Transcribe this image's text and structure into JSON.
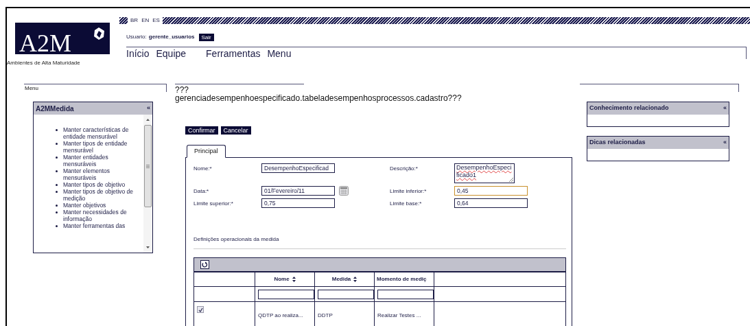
{
  "languages": [
    "BR",
    "EN",
    "ES"
  ],
  "logo": {
    "text": "A2M",
    "subtitle": "Ambientes de Alta Maturidade"
  },
  "user": {
    "label": "Usuario:",
    "name": "gerente_usuarios",
    "logout": "Sair"
  },
  "nav": [
    "Início",
    "Equipe",
    "Ferramentas",
    "Menu"
  ],
  "left_header": "Menu",
  "menu_box": {
    "title": "A2MMedida",
    "collapse": "«",
    "items": [
      "Manter características de entidade mensurável",
      "Manter tipos de entidade mensurável",
      "Manter entidades mensuráveis",
      "Manter elementos mensuráveis",
      "Manter tipos de objetivo",
      "Manter tipos de objetivo de medição",
      "Manter objetivos",
      "Manter necessidades de informação",
      "Manter ferramentas das"
    ]
  },
  "page_title": "???\ngerenciadesempenhoespecificado.tabeladesempenhosprocessos.cadastro???",
  "buttons": [
    "Confirmar",
    "Cancelar"
  ],
  "tabs": [
    {
      "label": "Principal",
      "selected": true
    }
  ],
  "form": [
    {
      "label": "Nome:*",
      "value": "DesempenhoEspecificad",
      "kind": "text",
      "focused": false
    },
    {
      "label": "Descrição:*",
      "value": "DesempenhoEspecificado1",
      "kind": "textarea",
      "focused": false
    },
    {
      "label": "Data:*",
      "value": "01/Fevereiro/11",
      "kind": "date",
      "focused": false
    },
    {
      "label": "Limite inferior:*",
      "value": "0,45",
      "kind": "text",
      "focused": true
    },
    {
      "label": "Limite superior:*",
      "value": "0,75",
      "kind": "text",
      "focused": false
    },
    {
      "label": "Limite base:*",
      "value": "0,64",
      "kind": "text",
      "focused": false
    }
  ],
  "section_title": "Definições operacionais da medida",
  "table": {
    "columns": [
      {
        "label": "Nome",
        "sortable": true
      },
      {
        "label": "Medida",
        "sortable": true
      },
      {
        "label": "Momento de mediç",
        "sortable": false
      }
    ],
    "rows": [
      {
        "checked": true,
        "cells": [
          "QDTP ao realiza...",
          "DDTP",
          "Realizar Testes ..."
        ]
      }
    ]
  },
  "right_panels": [
    {
      "title": "Conhecimento relacionado",
      "collapse": "«"
    },
    {
      "title": "Dicas relacionadas",
      "collapse": "«"
    }
  ]
}
